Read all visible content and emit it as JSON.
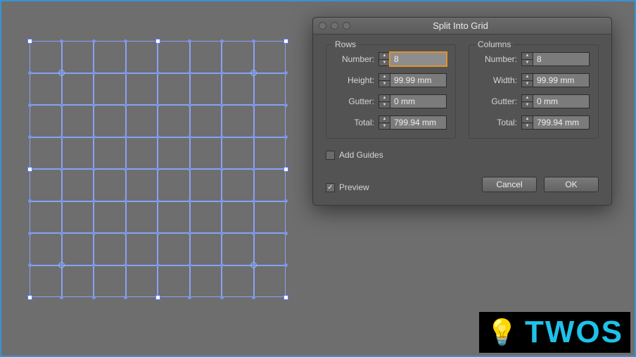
{
  "dialog": {
    "title": "Split Into Grid",
    "rows": {
      "legend": "Rows",
      "number_label": "Number:",
      "number_value": "8",
      "height_label": "Height:",
      "height_value": "99.99 mm",
      "gutter_label": "Gutter:",
      "gutter_value": "0 mm",
      "total_label": "Total:",
      "total_value": "799.94 mm"
    },
    "columns": {
      "legend": "Columns",
      "number_label": "Number:",
      "number_value": "8",
      "width_label": "Width:",
      "width_value": "99.99 mm",
      "gutter_label": "Gutter:",
      "gutter_value": "0 mm",
      "total_label": "Total:",
      "total_value": "799.94 mm"
    },
    "add_guides_label": "Add Guides",
    "add_guides_checked": false,
    "preview_label": "Preview",
    "preview_checked": true,
    "cancel_label": "Cancel",
    "ok_label": "OK"
  },
  "grid": {
    "rows": 8,
    "cols": 8
  },
  "logo_text": "TWOS"
}
